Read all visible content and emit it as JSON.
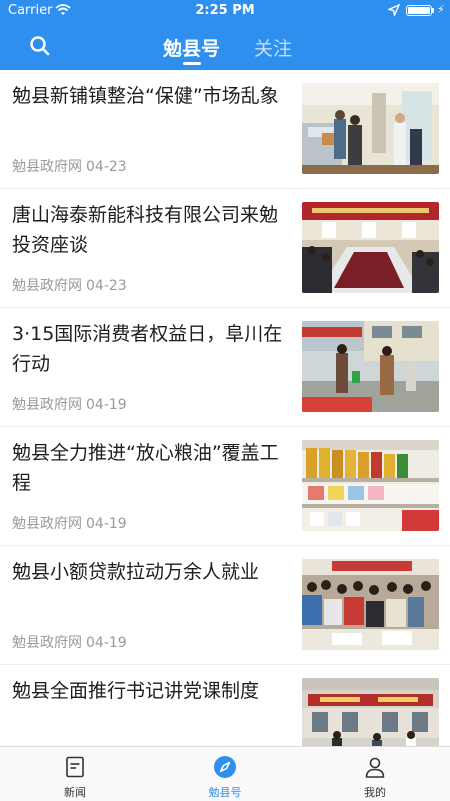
{
  "status_bar": {
    "carrier": "Carrier",
    "time": "2:25 PM",
    "battery_level": 1.0
  },
  "header": {
    "search_icon": "search-icon",
    "tabs": [
      {
        "label": "勉县号",
        "active": true
      },
      {
        "label": "关注",
        "active": false
      }
    ]
  },
  "articles": [
    {
      "title": "勉县新铺镇整治“保健”市场乱象",
      "source": "勉县政府网",
      "date": "04-23"
    },
    {
      "title": "唐山海泰新能科技有限公司来勉投资座谈",
      "source": "勉县政府网",
      "date": "04-23"
    },
    {
      "title": "3·15国际消费者权益日，阜川在行动",
      "source": "勉县政府网",
      "date": "04-19"
    },
    {
      "title": "勉县全力推进“放心粮油”覆盖工程",
      "source": "勉县政府网",
      "date": "04-19"
    },
    {
      "title": "勉县小额贷款拉动万余人就业",
      "source": "勉县政府网",
      "date": "04-19"
    },
    {
      "title": "勉县全面推行书记讲党课制度",
      "source": "",
      "date": ""
    }
  ],
  "bottom_nav": [
    {
      "label": "新闻",
      "icon": "news-icon",
      "active": false
    },
    {
      "label": "勉县号",
      "icon": "compass-icon",
      "active": true
    },
    {
      "label": "我的",
      "icon": "profile-icon",
      "active": false
    }
  ],
  "colors": {
    "primary": "#2f8fef",
    "text": "#1e1e1e",
    "meta": "#9a9a9a"
  }
}
